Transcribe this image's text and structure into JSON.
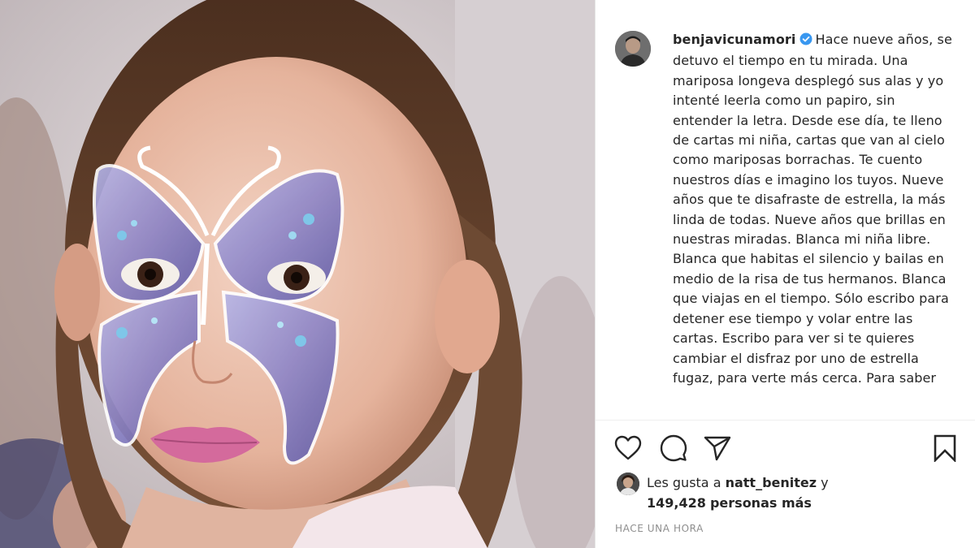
{
  "post": {
    "username": "benjavicunamori",
    "verified": true,
    "caption": "Hace nueve años, se detuvo el tiempo en tu mirada. Una mariposa longeva desplegó sus alas y yo intenté leerla como un papiro, sin entender la letra. Desde ese día, te lleno de cartas mi niña, cartas que van al cielo como mariposas borrachas. Te cuento nuestros días e imagino los tuyos. Nueve años que te disafraste de estrella, la más linda de todas. Nueve años que brillas en nuestras miradas. Blanca mi niña libre. Blanca que habitas el silencio y bailas en medio de la risa de tus hermanos. Blanca que viajas en el tiempo. Sólo escribo para detener ese tiempo y volar entre las cartas. Escribo para ver si te quieres cambiar el disfraz por uno de estrella fugaz, para verte más cerca. Para saber"
  },
  "actions": {
    "like_icon": "heart-icon",
    "comment_icon": "comment-bubble-icon",
    "share_icon": "paper-plane-icon",
    "save_icon": "bookmark-icon"
  },
  "likes": {
    "prefix": "Les gusta a",
    "liker": "natt_benitez",
    "joiner": "y",
    "count": "149,428",
    "suffix": "personas más"
  },
  "time_ago": "Hace una hora",
  "colors": {
    "text": "#262626",
    "muted": "#8e8e8e",
    "verified_blue": "#3897f0",
    "border": "#efefef"
  }
}
